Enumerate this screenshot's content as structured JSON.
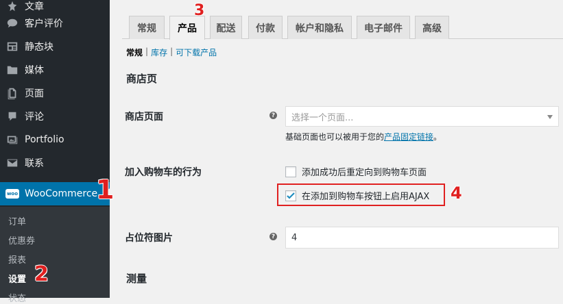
{
  "sidebar": {
    "items": [
      {
        "label": "文章",
        "icon": "pin-icon"
      },
      {
        "label": "客户评价",
        "icon": "comment-bubble-icon"
      },
      {
        "label": "静态块",
        "icon": "layout-icon"
      },
      {
        "label": "媒体",
        "icon": "media-icon"
      },
      {
        "label": "页面",
        "icon": "page-icon"
      },
      {
        "label": "评论",
        "icon": "comment-icon"
      },
      {
        "label": "Portfolio",
        "icon": "portfolio-icon"
      },
      {
        "label": "联系",
        "icon": "mail-icon"
      }
    ],
    "woocommerce": {
      "label": "WooCommerce",
      "badge": "woo"
    },
    "submenu": [
      "订单",
      "优惠券",
      "报表",
      "设置",
      "状态"
    ]
  },
  "annotations": [
    "1",
    "2",
    "3",
    "4"
  ],
  "tabs": [
    "常规",
    "产品",
    "配送",
    "付款",
    "帐户和隐私",
    "电子邮件",
    "高级"
  ],
  "subnav": {
    "current": "常规",
    "links": [
      "库存",
      "可下载产品"
    ],
    "separator": "|"
  },
  "shop_page": {
    "heading": "商店页",
    "shop_page_label": "商店页面",
    "select_placeholder": "选择一个页面...",
    "desc_prefix": "基础页面也可以被用于您的",
    "desc_link": "产品固定链接",
    "desc_suffix": "。",
    "cart_behavior_label": "加入购物车的行为",
    "redirect_label": "添加成功后重定向到购物车页面",
    "redirect_checked": false,
    "ajax_label": "在添加到购物车按钮上启用AJAX",
    "ajax_checked": true,
    "placeholder_label": "占位符图片",
    "placeholder_value": "4"
  },
  "measure": {
    "heading": "测量"
  },
  "help_glyph": "?",
  "colors": {
    "annotation": "#e02020",
    "accent": "#0073aa",
    "sidebar": "#23282d"
  }
}
